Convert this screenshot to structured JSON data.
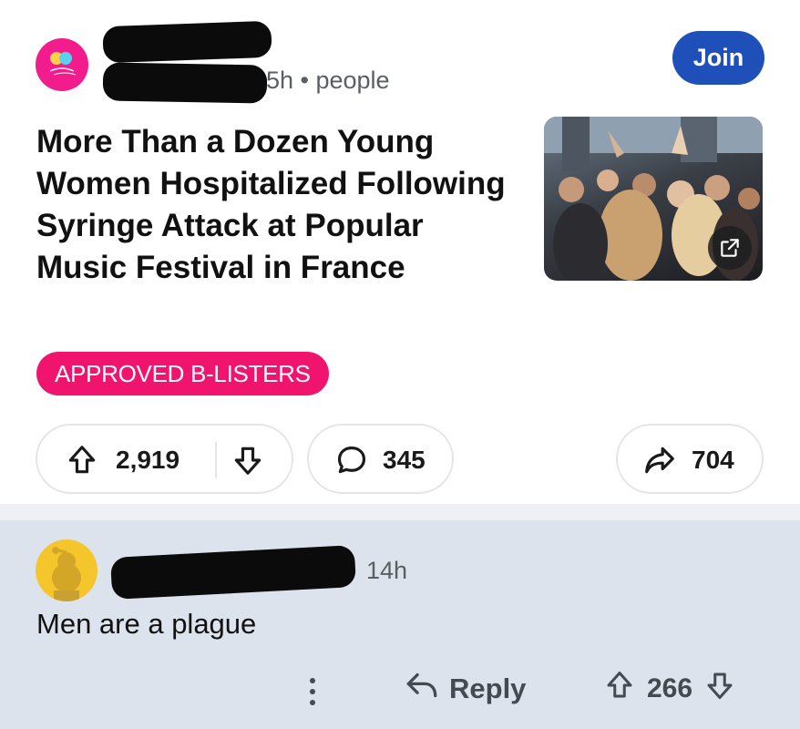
{
  "post": {
    "meta": "5h • people",
    "join_label": "Join",
    "title": "More Than a Dozen Young Women Hospitalized Following Syringe Attack at Popular Music Festival in France",
    "flair": "APPROVED B-LISTERS",
    "upvotes": "2,919",
    "comments": "345",
    "shares": "704",
    "colors": {
      "join": "#1f4fb8",
      "flair": "#f0146f",
      "subreddit_avatar": "#f21c8c"
    },
    "icons": [
      "upvote-icon",
      "downvote-icon",
      "comment-icon",
      "share-icon",
      "external-link-icon"
    ]
  },
  "comment": {
    "time": "14h",
    "body": "Men are a plague",
    "reply_label": "Reply",
    "votes": "266",
    "icons": [
      "more-options-icon",
      "reply-icon",
      "upvote-icon",
      "downvote-icon"
    ]
  }
}
